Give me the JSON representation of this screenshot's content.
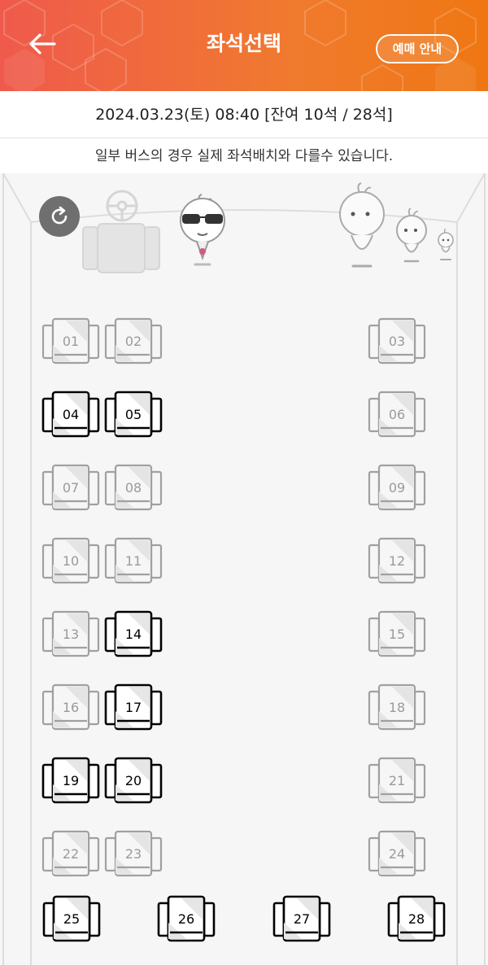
{
  "header": {
    "title": "좌석선택",
    "guide_label": "예매 안내",
    "back_icon": "arrow-left-icon"
  },
  "info": {
    "datetime": "2024.03.23(토) 08:40 [잔여 10석 / 28석]",
    "notice": "일부 버스의 경우 실제 좌석배치와 다를수 있습니다."
  },
  "colors": {
    "accent": "#f07a2e",
    "taken": "#9a9a9a",
    "free": "#000000"
  },
  "seats": [
    {
      "num": "01",
      "status": "taken"
    },
    {
      "num": "02",
      "status": "taken"
    },
    {
      "num": "03",
      "status": "taken"
    },
    {
      "num": "04",
      "status": "free"
    },
    {
      "num": "05",
      "status": "free"
    },
    {
      "num": "06",
      "status": "taken"
    },
    {
      "num": "07",
      "status": "taken"
    },
    {
      "num": "08",
      "status": "taken"
    },
    {
      "num": "09",
      "status": "taken"
    },
    {
      "num": "10",
      "status": "taken"
    },
    {
      "num": "11",
      "status": "taken"
    },
    {
      "num": "12",
      "status": "taken"
    },
    {
      "num": "13",
      "status": "taken"
    },
    {
      "num": "14",
      "status": "free"
    },
    {
      "num": "15",
      "status": "taken"
    },
    {
      "num": "16",
      "status": "taken"
    },
    {
      "num": "17",
      "status": "free"
    },
    {
      "num": "18",
      "status": "taken"
    },
    {
      "num": "19",
      "status": "free"
    },
    {
      "num": "20",
      "status": "free"
    },
    {
      "num": "21",
      "status": "taken"
    },
    {
      "num": "22",
      "status": "taken"
    },
    {
      "num": "23",
      "status": "taken"
    },
    {
      "num": "24",
      "status": "taken"
    },
    {
      "num": "25",
      "status": "free"
    },
    {
      "num": "26",
      "status": "free"
    },
    {
      "num": "27",
      "status": "free"
    },
    {
      "num": "28",
      "status": "free"
    }
  ]
}
